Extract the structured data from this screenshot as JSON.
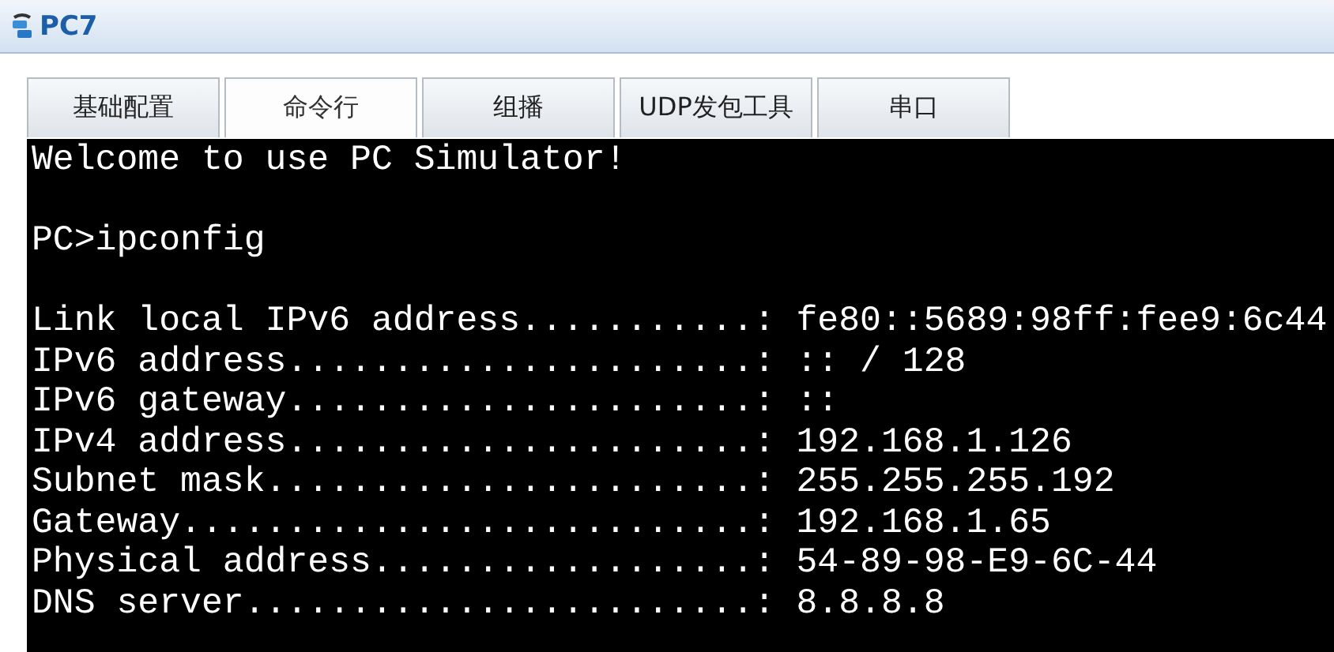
{
  "window": {
    "title": "PC7"
  },
  "tabs": [
    {
      "label": "基础配置",
      "selected": false
    },
    {
      "label": "命令行",
      "selected": true
    },
    {
      "label": "组播",
      "selected": false
    },
    {
      "label": "UDP发包工具",
      "selected": false
    },
    {
      "label": "串口",
      "selected": false
    }
  ],
  "terminal": {
    "blocks": [
      [
        "Welcome to use PC Simulator!"
      ],
      [
        "PC>ipconfig"
      ],
      [
        "Link local IPv6 address...........: fe80::5689:98ff:fee9:6c44",
        "IPv6 address......................: :: / 128",
        "IPv6 gateway......................: ::",
        "IPv4 address......................: 192.168.1.126",
        "Subnet mask.......................: 255.255.255.192",
        "Gateway...........................: 192.168.1.65",
        "Physical address..................: 54-89-98-E9-6C-44",
        "DNS server........................: 8.8.8.8"
      ]
    ]
  }
}
